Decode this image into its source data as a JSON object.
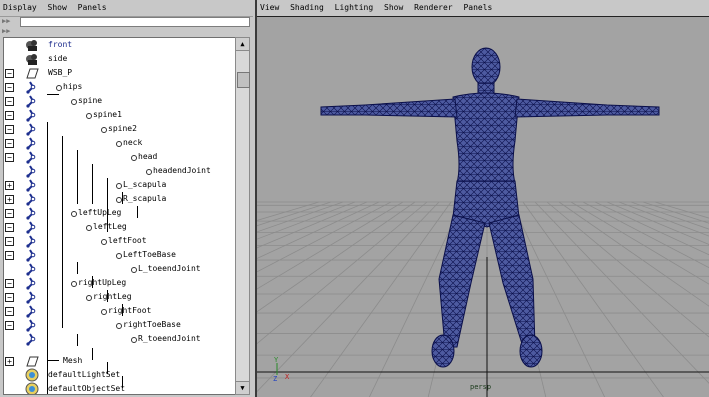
{
  "outliner": {
    "menu": [
      "Display",
      "Show",
      "Panels"
    ],
    "filter_button": "▶▶"
  },
  "tree": {
    "items": [
      {
        "label": "front",
        "icon": "camera-icon",
        "expander": ""
      },
      {
        "label": "side",
        "icon": "camera-icon",
        "expander": ""
      },
      {
        "label": "WSB_P",
        "icon": "transform-icon",
        "expander": "−"
      },
      {
        "label": "hips",
        "icon": "joint-icon",
        "expander": "−"
      },
      {
        "label": "spine",
        "icon": "joint-icon",
        "expander": "−"
      },
      {
        "label": "spine1",
        "icon": "joint-icon",
        "expander": "−"
      },
      {
        "label": "spine2",
        "icon": "joint-icon",
        "expander": "−"
      },
      {
        "label": "neck",
        "icon": "joint-icon",
        "expander": "−"
      },
      {
        "label": "head",
        "icon": "joint-icon",
        "expander": "−"
      },
      {
        "label": "headendJoint",
        "icon": "joint-icon",
        "expander": ""
      },
      {
        "label": "L_scapula",
        "icon": "joint-icon",
        "expander": "+"
      },
      {
        "label": "R_scapula",
        "icon": "joint-icon",
        "expander": "+"
      },
      {
        "label": "leftUpLeg",
        "icon": "joint-icon",
        "expander": "−"
      },
      {
        "label": "leftLeg",
        "icon": "joint-icon",
        "expander": "−"
      },
      {
        "label": "leftFoot",
        "icon": "joint-icon",
        "expander": "−"
      },
      {
        "label": "LeftToeBase",
        "icon": "joint-icon",
        "expander": "−"
      },
      {
        "label": "L_toeendJoint",
        "icon": "joint-icon",
        "expander": ""
      },
      {
        "label": "rightUpLeg",
        "icon": "joint-icon",
        "expander": "−"
      },
      {
        "label": "rightLeg",
        "icon": "joint-icon",
        "expander": "−"
      },
      {
        "label": "rightFoot",
        "icon": "joint-icon",
        "expander": "−"
      },
      {
        "label": "rightToeBase",
        "icon": "joint-icon",
        "expander": "−"
      },
      {
        "label": "R_toeendJoint",
        "icon": "joint-icon",
        "expander": ""
      },
      {
        "label": "Mesh",
        "icon": "transform-icon",
        "expander": "+"
      },
      {
        "label": "defaultLightSet",
        "icon": "set-icon",
        "expander": ""
      },
      {
        "label": "defaultObjectSet",
        "icon": "set-icon",
        "expander": ""
      }
    ]
  },
  "viewport": {
    "menu": [
      "View",
      "Shading",
      "Lighting",
      "Show",
      "Renderer",
      "Panels"
    ],
    "camera_label": "persp",
    "axis_labels": {
      "y": "Y",
      "z": "Z",
      "x": "X"
    },
    "colors": {
      "background": "#a3a3a3",
      "mesh_fill": "#4d5aa0",
      "mesh_wire": "#0a0f4a",
      "grid": "#8c8c8c"
    }
  }
}
